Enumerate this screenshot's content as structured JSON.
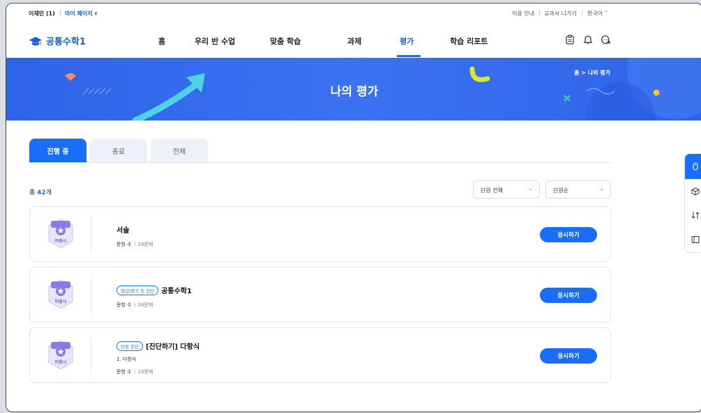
{
  "topbar": {
    "user": "이재민 (1)",
    "mypage": "마이 페이지 ▾",
    "guide": "이용 안내",
    "exit": "교과서 나가기",
    "language": "한국어 ˅"
  },
  "nav": {
    "logo": "공통수학1",
    "items": [
      "홈",
      "우리 반 수업",
      "맞춤 학습",
      "과제",
      "평가",
      "학습 리포트"
    ],
    "active_index": 4
  },
  "banner": {
    "title": "나의 평가",
    "breadcrumb": "홈 > 나의 평가"
  },
  "tabs": [
    "진행 중",
    "종료",
    "전체"
  ],
  "summary": {
    "prefix": "총 ",
    "count": "42",
    "suffix": "개"
  },
  "filters": {
    "unit": "단원 전체",
    "sort": "단원순"
  },
  "cards": [
    {
      "badge": "미응시",
      "chip": "",
      "title": "서술",
      "sub": "",
      "meta_label": "문항 수",
      "meta_value": "20문제",
      "button": "응시하기"
    },
    {
      "badge": "미응시",
      "chip": "학년/학기 초 진단",
      "title": "공통수학1",
      "sub": "",
      "meta_label": "문항 수",
      "meta_value": "20문제",
      "button": "응시하기"
    },
    {
      "badge": "미응시",
      "chip": "단원 진단",
      "title": "[진단하기] 다항식",
      "sub": "1. 다항식",
      "meta_label": "문항 수",
      "meta_value": "10문제",
      "button": "응시하기"
    }
  ],
  "colors": {
    "primary": "#1a6ef5",
    "banner": "#3a72f0",
    "badge": "#8a7ae6"
  }
}
